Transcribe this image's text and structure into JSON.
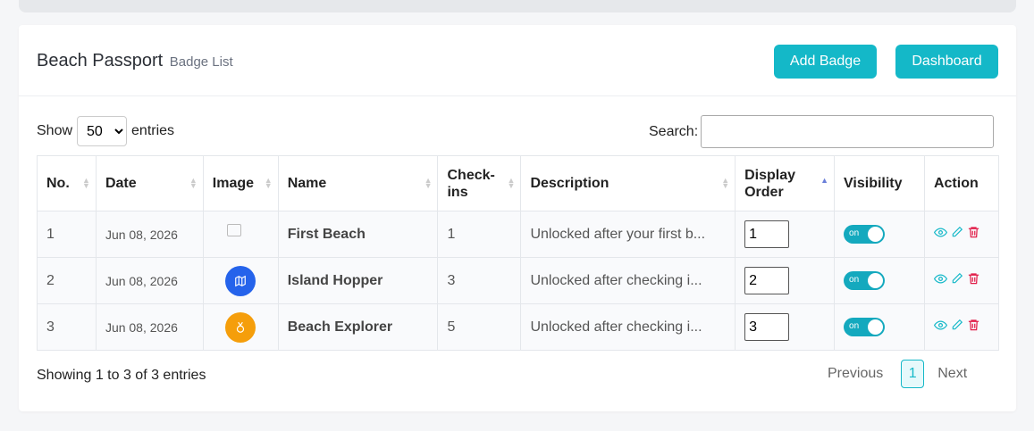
{
  "header": {
    "title": "Beach Passport",
    "subtitle": "Badge List",
    "add_button": "Add Badge",
    "dashboard_button": "Dashboard"
  },
  "controls": {
    "show_label": "Show",
    "entries_value": "50",
    "entries_label": "entries",
    "search_label": "Search:",
    "search_value": ""
  },
  "table": {
    "columns": [
      "No.",
      "Date",
      "Image",
      "Name",
      "Check-ins",
      "Description",
      "Display Order",
      "Visibility",
      "Action"
    ],
    "rows": [
      {
        "no": "1",
        "date": "Jun 08, 2026",
        "image": "broken-image-icon",
        "name": "First Beach",
        "checkins": "1",
        "description": "Unlocked after your first b...",
        "order": "1",
        "visibility": "on"
      },
      {
        "no": "2",
        "date": "Jun 08, 2026",
        "image": "map-icon",
        "image_color": "#2563eb",
        "name": "Island Hopper",
        "checkins": "3",
        "description": "Unlocked after checking i...",
        "order": "2",
        "visibility": "on"
      },
      {
        "no": "3",
        "date": "Jun 08, 2026",
        "image": "medal-icon",
        "image_color": "#f59e0b",
        "name": "Beach Explorer",
        "checkins": "5",
        "description": "Unlocked after checking i...",
        "order": "3",
        "visibility": "on"
      }
    ]
  },
  "footer": {
    "info": "Showing 1 to 3 of 3 entries",
    "previous": "Previous",
    "page": "1",
    "next": "Next"
  },
  "colors": {
    "accent": "#14b8c8",
    "delete": "#e11d48"
  }
}
